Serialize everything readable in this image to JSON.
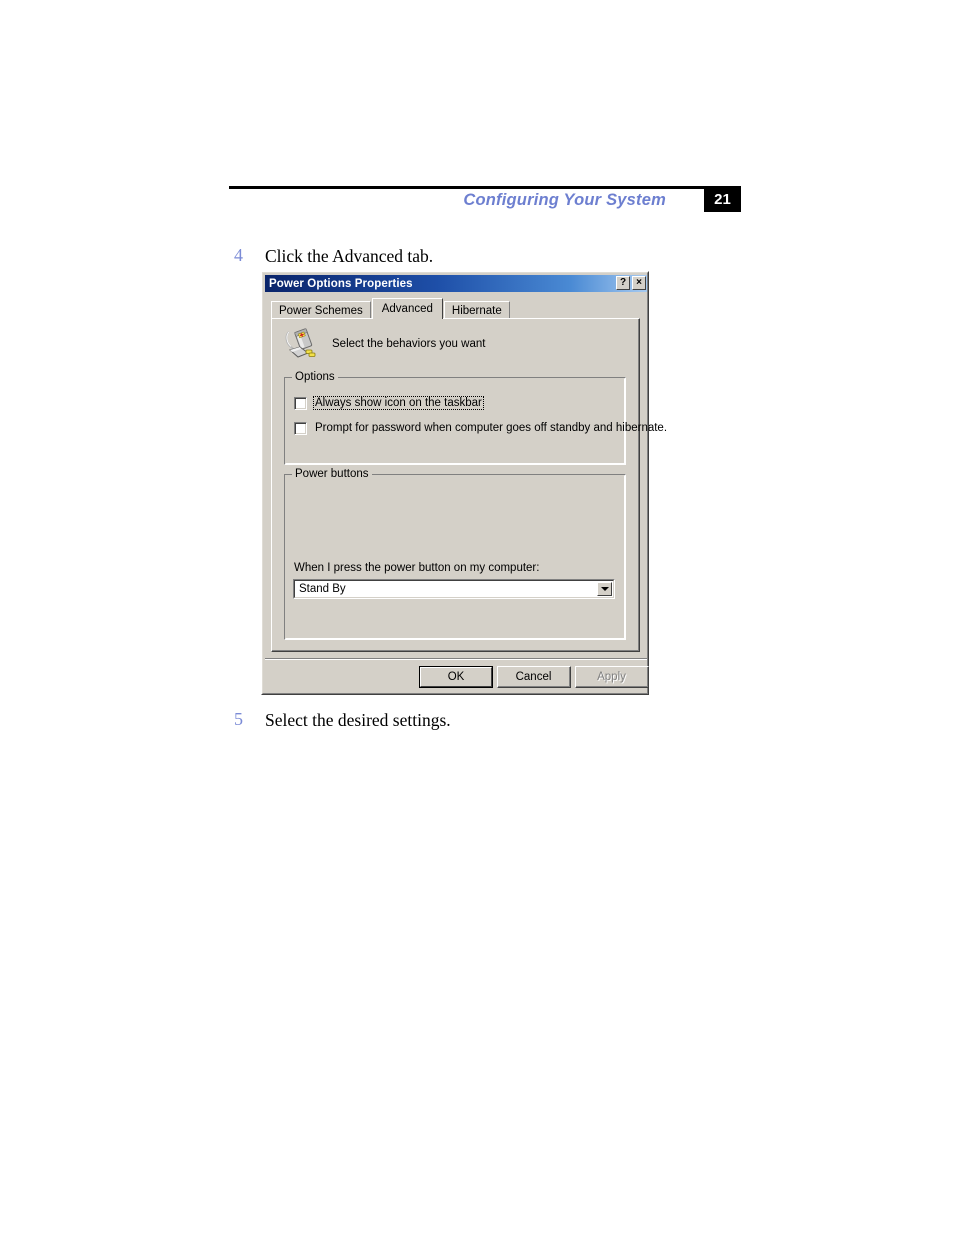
{
  "page": {
    "header_title": "Configuring Your System",
    "page_number": "21"
  },
  "steps": [
    {
      "number": "4",
      "text": "Click the Advanced tab."
    },
    {
      "number": "5",
      "text": "Select the desired settings."
    }
  ],
  "dialog": {
    "title": "Power Options Properties",
    "titlebar_buttons": [
      {
        "name": "help-button",
        "glyph": "?"
      },
      {
        "name": "close-button",
        "glyph": "×"
      }
    ],
    "tabs": [
      {
        "label": "Power Schemes",
        "active": false
      },
      {
        "label": "Advanced",
        "active": true
      },
      {
        "label": "Hibernate",
        "active": false
      }
    ],
    "panel": {
      "icon": "power-plug-icon",
      "caption": "Select the behaviors you want",
      "options_group": {
        "legend": "Options",
        "checkboxes": [
          {
            "label": "Always show icon on the taskbar",
            "checked": false,
            "focused": true,
            "accel_prefix": "A",
            "accel_rest": "lways show ",
            "accel2": "i",
            "accel2_rest": "con on the taskbar"
          },
          {
            "label": "Prompt for password when computer goes off standby and hibernate.",
            "checked": false,
            "focused": false
          }
        ]
      },
      "power_buttons_group": {
        "legend": "Power buttons",
        "combo_label": "When I press the power button on my computer:",
        "combo_value": "Stand By",
        "combo_options": [
          "Stand By"
        ],
        "arrow_icon": "chevron-down-icon"
      }
    },
    "buttons": [
      {
        "label": "OK",
        "default": true,
        "disabled": false
      },
      {
        "label": "Cancel",
        "default": false,
        "disabled": false
      },
      {
        "label": "Apply",
        "default": false,
        "disabled": true
      }
    ]
  },
  "colors": {
    "accent_blue": "#6d7fd0",
    "step_number": "#7b8bd6",
    "dialog_face": "#d4d0c8",
    "titlebar_start": "#0a246a",
    "titlebar_end": "#a6caf0"
  }
}
